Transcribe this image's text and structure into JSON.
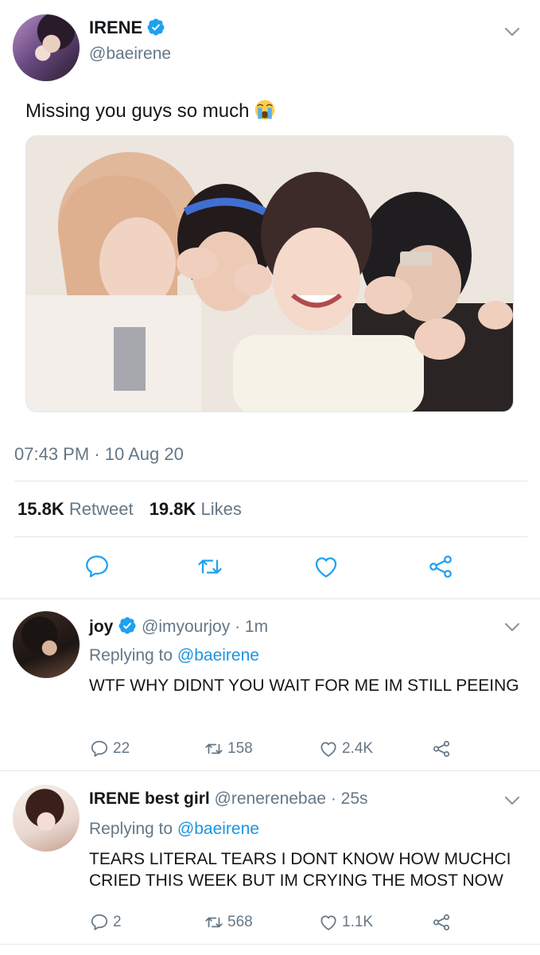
{
  "tweet": {
    "author_name": "IRENE",
    "author_handle": "@baeirene",
    "verified": true,
    "text": "Missing you guys so much",
    "emoji": "loudly-crying-face",
    "timestamp": "07:43 PM · 10 Aug 20",
    "retweets": "15.8K",
    "retweets_label": "Retweet",
    "likes": "19.8K",
    "likes_label": "Likes"
  },
  "replies": [
    {
      "name": "joy",
      "verified": true,
      "handle": "@imyourjoy",
      "time": "· 1m",
      "replying_label": "Replying to",
      "replying_to": "@baeirene",
      "text": "WTF WHY DIDNT YOU WAIT FOR ME IM STILL PEEING",
      "replies_count": "22",
      "retweets_count": "158",
      "likes_count": "2.4K"
    },
    {
      "name": "IRENE best girl",
      "verified": false,
      "handle": "@renerenebae",
      "time": "· 25s",
      "replying_label": "Replying to",
      "replying_to": "@baeirene",
      "text": "TEARS LITERAL TEARS I DONT KNOW HOW MUCHCI CRIED THIS WEEK BUT IM CRYING THE MOST NOW",
      "replies_count": "2",
      "retweets_count": "568",
      "likes_count": "1.1K"
    }
  ],
  "colors": {
    "accent": "#1b95e0",
    "muted": "#657786",
    "text": "#14171a",
    "divider": "#e1e8ed"
  },
  "icons": [
    "verified-badge-icon",
    "chevron-down-icon",
    "reply-icon",
    "retweet-icon",
    "like-icon",
    "share-icon"
  ]
}
